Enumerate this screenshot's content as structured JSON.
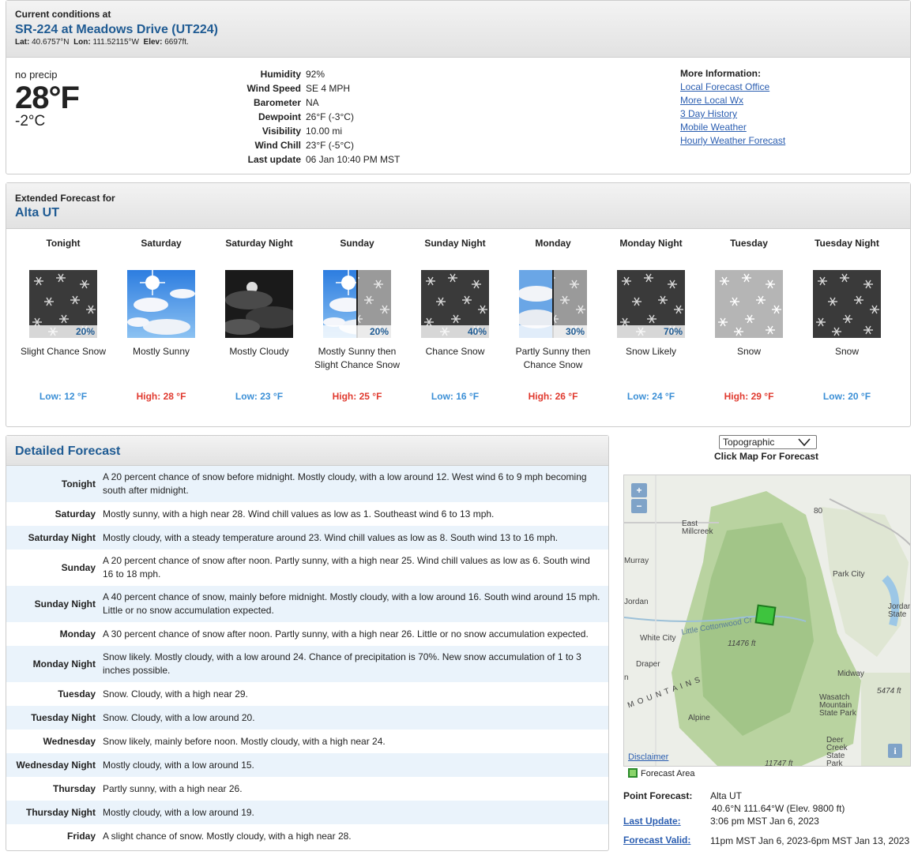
{
  "current": {
    "heading": "Current conditions at",
    "station": "SR-224 at Meadows Drive (UT224)",
    "lat_label": "Lat:",
    "lat": "40.6757°N",
    "lon_label": "Lon:",
    "lon": "111.52115°W",
    "elev_label": "Elev:",
    "elev": "6697ft.",
    "precip": "no precip",
    "temp_f": "28°F",
    "temp_c": "-2°C",
    "details": [
      {
        "k": "Humidity",
        "v": "92%"
      },
      {
        "k": "Wind Speed",
        "v": "SE 4 MPH"
      },
      {
        "k": "Barometer",
        "v": "NA"
      },
      {
        "k": "Dewpoint",
        "v": "26°F (-3°C)"
      },
      {
        "k": "Visibility",
        "v": "10.00 mi"
      },
      {
        "k": "Wind Chill",
        "v": "23°F (-5°C)"
      },
      {
        "k": "Last update",
        "v": "06 Jan 10:40 PM MST"
      }
    ],
    "more_title": "More Information:",
    "links": [
      "Local Forecast Office",
      "More Local Wx",
      "3 Day History",
      "Mobile Weather",
      "Hourly Weather Forecast"
    ]
  },
  "extended": {
    "heading": "Extended Forecast for",
    "city": "Alta UT",
    "periods": [
      {
        "name": "Tonight",
        "icon": "snow-dark-icon",
        "pct": "20%",
        "desc": "Slight Chance Snow",
        "temp": "Low: 12 °F",
        "kind": "low"
      },
      {
        "name": "Saturday",
        "icon": "sunny-icon",
        "pct": "",
        "desc": "Mostly Sunny",
        "temp": "High: 28 °F",
        "kind": "high"
      },
      {
        "name": "Saturday Night",
        "icon": "night-cloudy-icon",
        "pct": "",
        "desc": "Mostly Cloudy",
        "temp": "Low: 23 °F",
        "kind": "low"
      },
      {
        "name": "Sunday",
        "icon": "sun-then-snow-icon",
        "pct": "20%",
        "desc": "Mostly Sunny then Slight Chance Snow",
        "temp": "High: 25 °F",
        "kind": "high"
      },
      {
        "name": "Sunday Night",
        "icon": "snow-dark-icon",
        "pct": "40%",
        "desc": "Chance Snow",
        "temp": "Low: 16 °F",
        "kind": "low"
      },
      {
        "name": "Monday",
        "icon": "partly-sunny-then-snow-icon",
        "pct": "30%",
        "desc": "Partly Sunny then Chance Snow",
        "temp": "High: 26 °F",
        "kind": "high"
      },
      {
        "name": "Monday Night",
        "icon": "snow-dark-icon",
        "pct": "70%",
        "desc": "Snow Likely",
        "temp": "Low: 24 °F",
        "kind": "low"
      },
      {
        "name": "Tuesday",
        "icon": "snow-light-icon",
        "pct": "",
        "desc": "Snow",
        "temp": "High: 29 °F",
        "kind": "high"
      },
      {
        "name": "Tuesday Night",
        "icon": "snow-dark-icon",
        "pct": "",
        "desc": "Snow",
        "temp": "Low: 20 °F",
        "kind": "low"
      }
    ]
  },
  "detailed": {
    "title": "Detailed Forecast",
    "rows": [
      {
        "k": "Tonight",
        "v": "A 20 percent chance of snow before midnight. Mostly cloudy, with a low around 12. West wind 6 to 9 mph becoming south after midnight."
      },
      {
        "k": "Saturday",
        "v": "Mostly sunny, with a high near 28. Wind chill values as low as 1. Southeast wind 6 to 13 mph."
      },
      {
        "k": "Saturday Night",
        "v": "Mostly cloudy, with a steady temperature around 23. Wind chill values as low as 8. South wind 13 to 16 mph."
      },
      {
        "k": "Sunday",
        "v": "A 20 percent chance of snow after noon. Partly sunny, with a high near 25. Wind chill values as low as 6. South wind 16 to 18 mph."
      },
      {
        "k": "Sunday Night",
        "v": "A 40 percent chance of snow, mainly before midnight. Mostly cloudy, with a low around 16. South wind around 15 mph. Little or no snow accumulation expected."
      },
      {
        "k": "Monday",
        "v": "A 30 percent chance of snow after noon. Partly sunny, with a high near 26. Little or no snow accumulation expected."
      },
      {
        "k": "Monday Night",
        "v": "Snow likely. Mostly cloudy, with a low around 24. Chance of precipitation is 70%. New snow accumulation of 1 to 3 inches possible."
      },
      {
        "k": "Tuesday",
        "v": "Snow. Cloudy, with a high near 29."
      },
      {
        "k": "Tuesday Night",
        "v": "Snow. Cloudy, with a low around 20."
      },
      {
        "k": "Wednesday",
        "v": "Snow likely, mainly before noon. Mostly cloudy, with a high near 24."
      },
      {
        "k": "Wednesday Night",
        "v": "Mostly cloudy, with a low around 15."
      },
      {
        "k": "Thursday",
        "v": "Partly sunny, with a high near 26."
      },
      {
        "k": "Thursday Night",
        "v": "Mostly cloudy, with a low around 19."
      },
      {
        "k": "Friday",
        "v": "A slight chance of snow. Mostly cloudy, with a high near 28."
      }
    ]
  },
  "map": {
    "select_value": "Topographic",
    "title": "Click Map For Forecast",
    "zoom_in": "+",
    "zoom_out": "−",
    "info": "i",
    "disclaimer": "Disclaimer",
    "legend": "Forecast Area",
    "labels": {
      "east_millcreek": "East Millcreek",
      "murray": "Murray",
      "park_city": "Park City",
      "jordan_state": "Jordan State",
      "jordan": "Jordan",
      "white_city": "White City",
      "little_cottonwood": "Little Cottonwood Cr",
      "elev1": "11476 ft",
      "draper": "Draper",
      "midway": "Midway",
      "elev2": "5474 ft",
      "wasatch": "Wasatch Mountain State Park",
      "mountains": "M O U N T A I N S",
      "alpine": "Alpine",
      "deer_creek": "Deer Creek State Park",
      "elev3": "11747 ft",
      "n_label": "n",
      "road": "80"
    }
  },
  "point": {
    "pf_label": "Point Forecast:",
    "pf_name": "Alta UT",
    "pf_coords": "40.6°N 111.64°W (Elev. 9800 ft)",
    "lu_label": "Last Update:",
    "lu_value": "3:06 pm MST Jan 6, 2023",
    "fv_label": "Forecast Valid:",
    "fv_value": "11pm MST Jan 6, 2023-6pm MST Jan 13, 2023"
  }
}
